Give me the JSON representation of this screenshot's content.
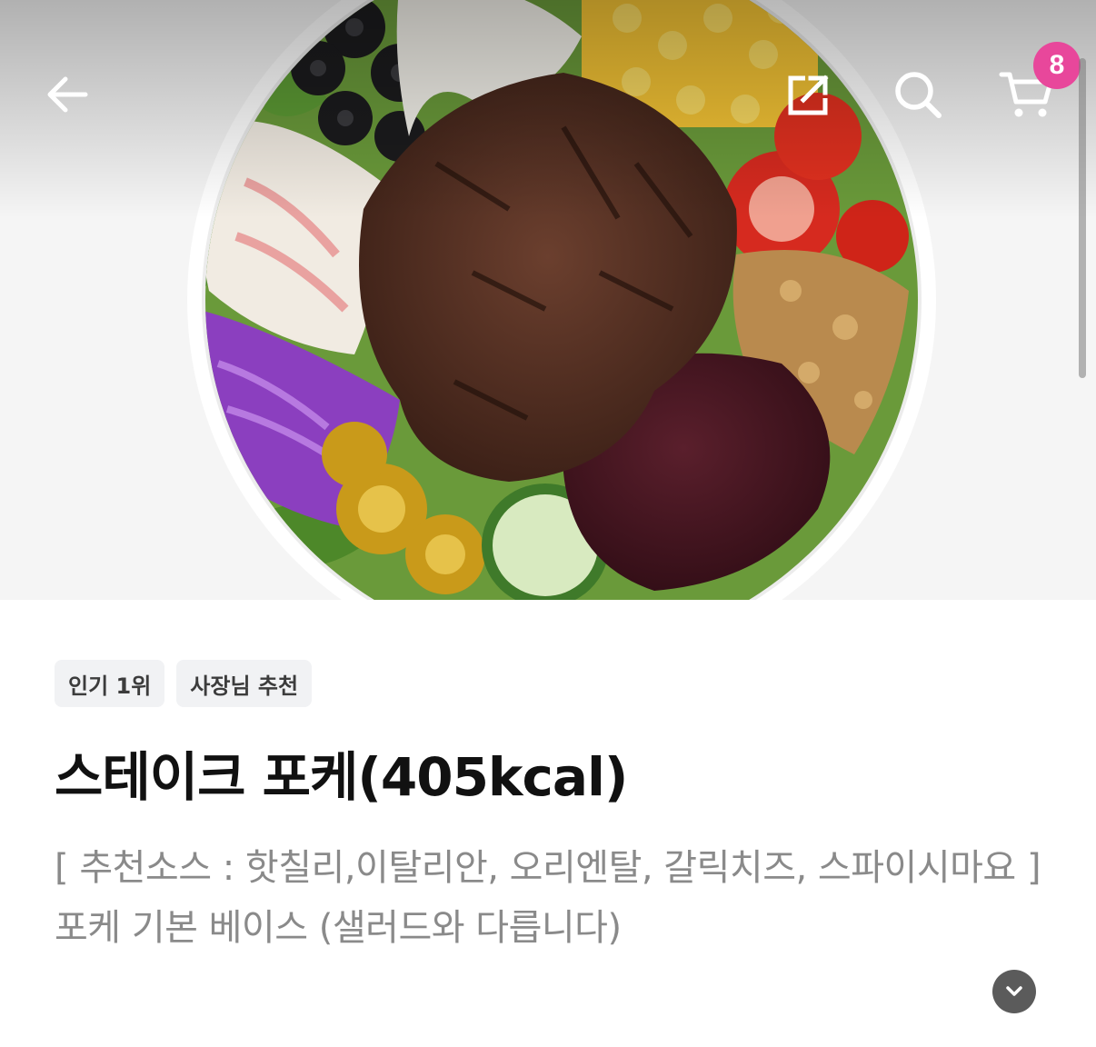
{
  "header": {
    "back_icon": "arrow-left-icon",
    "share_icon": "share-icon",
    "search_icon": "search-icon",
    "cart_icon": "cart-icon",
    "cart_count": "8",
    "badge_color": "#e8479b"
  },
  "hero": {
    "image": "steak-poke-bowl-photo"
  },
  "product": {
    "tags": [
      "인기 1위",
      "사장님 추천"
    ],
    "title": "스테이크 포케(405kcal)",
    "description_line1": "[ 추천소스 : 핫칠리,이탈리안, 오리엔탈, 갈릭치즈, 스파이시마요 ]",
    "description_line2": "포케 기본 베이스 (샐러드와 다릅니다)",
    "expand_icon": "chevron-down-icon"
  }
}
